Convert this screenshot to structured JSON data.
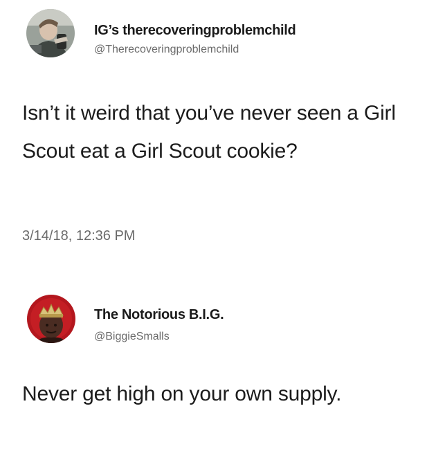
{
  "tweets": [
    {
      "display_name": "IG’s therecoveringproblemchild",
      "handle": "@Therecoveringproblemchild",
      "text": "Isn’t it weird that you’ve never seen a Girl Scout eat a Girl Scout cookie?",
      "timestamp": "3/14/18, 12:36 PM"
    },
    {
      "display_name": "The Notorious B.I.G.",
      "handle": "@BiggieSmalls",
      "text": "Never get high on your own supply."
    }
  ]
}
